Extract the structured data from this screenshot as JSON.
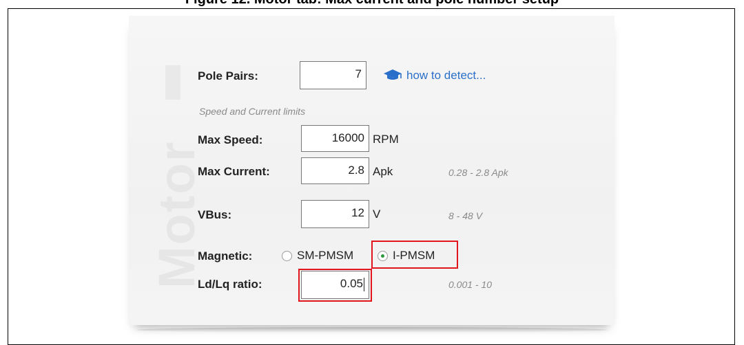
{
  "caption": "Figure 12. Motor tab: Max current and pole number setup",
  "watermark": "Motor",
  "pole_pairs": {
    "label": "Pole Pairs:",
    "value": "7",
    "help_link": "how to detect..."
  },
  "limits_section": {
    "title": "Speed and Current limits",
    "max_speed": {
      "label": "Max Speed:",
      "value": "16000",
      "unit": "RPM"
    },
    "max_current": {
      "label": "Max Current:",
      "value": "2.8",
      "unit": "Apk",
      "range": "0.28 - 2.8 Apk"
    }
  },
  "vbus": {
    "label": "VBus:",
    "value": "12",
    "unit": "V",
    "range": "8 - 48 V"
  },
  "magnetic": {
    "label": "Magnetic:",
    "options": [
      "SM-PMSM",
      "I-PMSM"
    ],
    "selected": "I-PMSM"
  },
  "ld_lq": {
    "label": "Ld/Lq ratio:",
    "value": "0.05",
    "range": "0.001 - 10"
  },
  "colors": {
    "highlight": "#e0141a",
    "link": "#2a6fc9",
    "radio_selected": "#2e9a3e"
  }
}
